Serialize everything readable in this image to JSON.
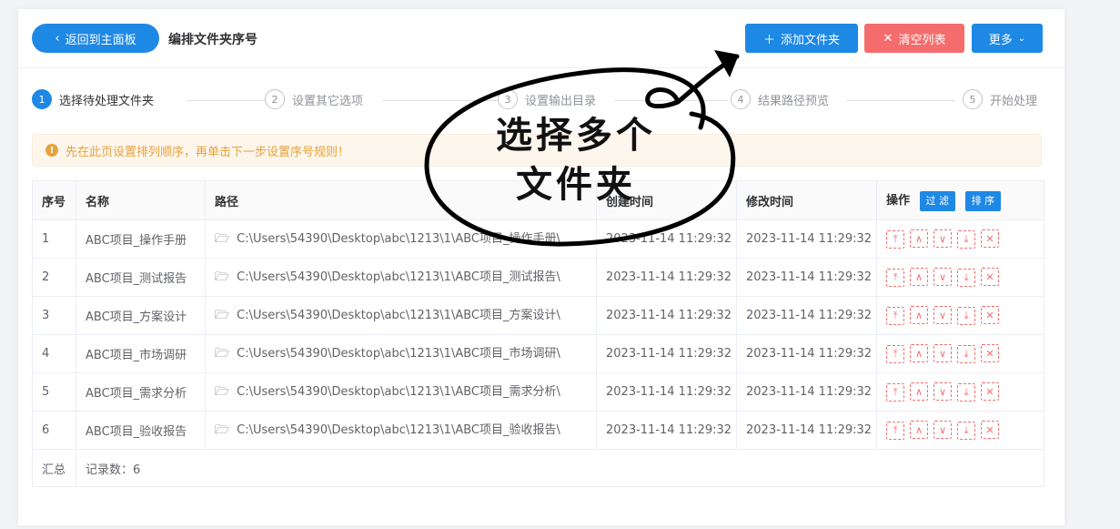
{
  "header": {
    "back_label": "返回到主面板",
    "title": "编排文件夹序号",
    "add_label": "添加文件夹",
    "clear_label": "清空列表",
    "more_label": "更多"
  },
  "steps": [
    {
      "num": "1",
      "label": "选择待处理文件夹"
    },
    {
      "num": "2",
      "label": "设置其它选项"
    },
    {
      "num": "3",
      "label": "设置输出目录"
    },
    {
      "num": "4",
      "label": "结果路径预览"
    },
    {
      "num": "5",
      "label": "开始处理"
    }
  ],
  "alert": {
    "text": "先在此页设置排列顺序，再单击下一步设置序号规则！"
  },
  "table": {
    "headers": {
      "index": "序号",
      "name": "名称",
      "path": "路径",
      "created": "创建时间",
      "modified": "修改时间",
      "actions": "操作",
      "filter": "过 滤",
      "sort": "排 序"
    },
    "rows": [
      {
        "index": "1",
        "name": "ABC项目_操作手册",
        "path": "C:\\Users\\54390\\Desktop\\abc\\1213\\1\\ABC项目_操作手册\\",
        "created": "2023-11-14 11:29:32",
        "modified": "2023-11-14 11:29:32"
      },
      {
        "index": "2",
        "name": "ABC项目_测试报告",
        "path": "C:\\Users\\54390\\Desktop\\abc\\1213\\1\\ABC项目_测试报告\\",
        "created": "2023-11-14 11:29:32",
        "modified": "2023-11-14 11:29:32"
      },
      {
        "index": "3",
        "name": "ABC项目_方案设计",
        "path": "C:\\Users\\54390\\Desktop\\abc\\1213\\1\\ABC项目_方案设计\\",
        "created": "2023-11-14 11:29:32",
        "modified": "2023-11-14 11:29:32"
      },
      {
        "index": "4",
        "name": "ABC项目_市场调研",
        "path": "C:\\Users\\54390\\Desktop\\abc\\1213\\1\\ABC项目_市场调研\\",
        "created": "2023-11-14 11:29:32",
        "modified": "2023-11-14 11:29:32"
      },
      {
        "index": "5",
        "name": "ABC项目_需求分析",
        "path": "C:\\Users\\54390\\Desktop\\abc\\1213\\1\\ABC项目_需求分析\\",
        "created": "2023-11-14 11:29:32",
        "modified": "2023-11-14 11:29:32"
      },
      {
        "index": "6",
        "name": "ABC项目_验收报告",
        "path": "C:\\Users\\54390\\Desktop\\abc\\1213\\1\\ABC项目_验收报告\\",
        "created": "2023-11-14 11:29:32",
        "modified": "2023-11-14 11:29:32"
      }
    ],
    "summary": {
      "label": "汇总",
      "count_text": "记录数：6"
    },
    "action_icons": [
      "move-top-icon",
      "move-up-icon",
      "move-down-icon",
      "move-bottom-icon",
      "delete-icon"
    ]
  },
  "annotation": {
    "line1": "选择多个",
    "line2": "文件夹"
  },
  "colors": {
    "primary": "#1e88e5",
    "danger": "#f56c6c",
    "warning": "#e6a23c"
  }
}
